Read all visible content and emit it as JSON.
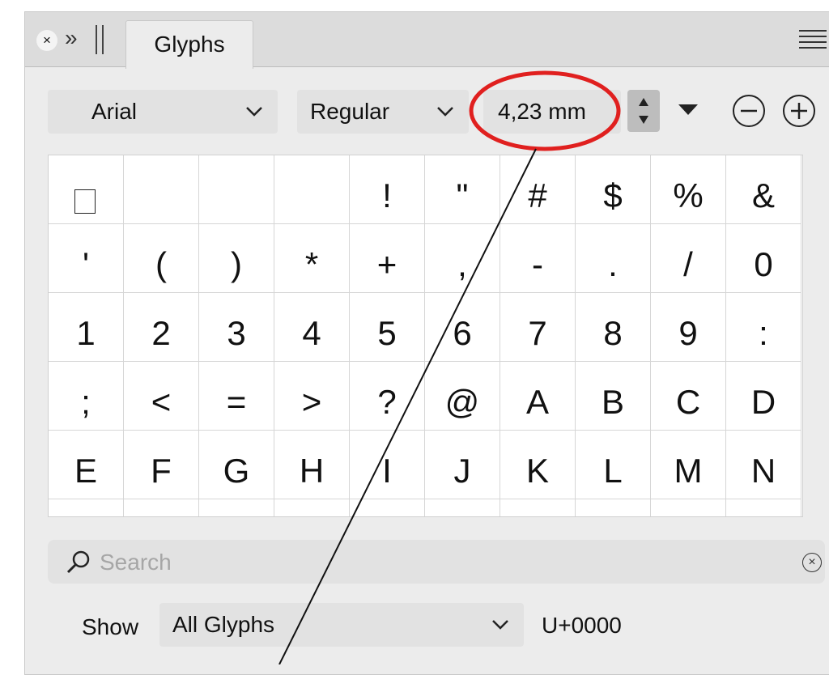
{
  "panel": {
    "tab_title": "Glyphs",
    "header_icons": [
      "close-icon",
      "collapse-chevron-icon",
      "drag-grip-icon",
      "panel-menu-icon"
    ]
  },
  "toolbar": {
    "font_family": "Arial",
    "font_style": "Regular",
    "font_size": "4,23 mm",
    "buttons": [
      "size-stepper",
      "size-presets-arrow",
      "zoom-out",
      "zoom-in"
    ]
  },
  "glyphs": [
    "",
    "",
    "",
    "",
    "!",
    "\"",
    "#",
    "$",
    "%",
    "&",
    "'",
    "(",
    ")",
    "*",
    "+",
    ",",
    "-",
    ".",
    "/",
    "0",
    "1",
    "2",
    "3",
    "4",
    "5",
    "6",
    "7",
    "8",
    "9",
    ":",
    ";",
    "<",
    "=",
    ">",
    "?",
    "@",
    "A",
    "B",
    "C",
    "D",
    "E",
    "F",
    "G",
    "H",
    "I",
    "J",
    "K",
    "L",
    "M",
    "N"
  ],
  "search": {
    "placeholder": "Search",
    "value": ""
  },
  "footer": {
    "show_label": "Show",
    "show_value": "All Glyphs",
    "unicode": "U+0000"
  },
  "annotation": {
    "color": "#e0201f",
    "highlighted": "font-size-field"
  }
}
